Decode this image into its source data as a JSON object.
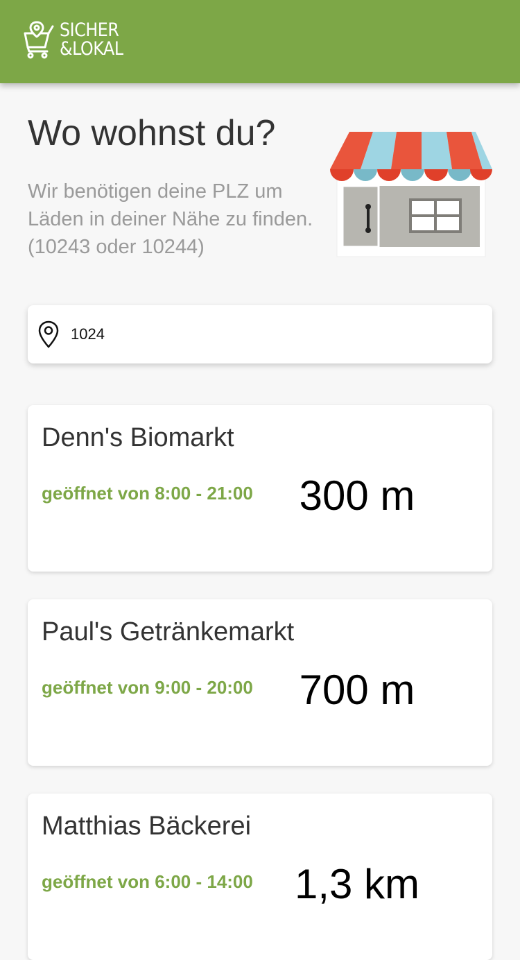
{
  "colors": {
    "brand": "#7da747",
    "text": "#333333",
    "muted": "#9a9a9a"
  },
  "header": {
    "logo_line1": "SICHER",
    "logo_line2": "&LOKAL",
    "logo_icon": "cart-pin-icon"
  },
  "hero": {
    "title": "Wo wohnst du?",
    "subtitle": "Wir benötigen deine PLZ um Läden in deiner Nähe zu finden. (10243 oder 10244)",
    "illustration": "storefront-icon"
  },
  "search": {
    "icon": "location-pin-icon",
    "value": "1024",
    "placeholder": ""
  },
  "stores": [
    {
      "name": "Denn's Biomarkt",
      "hours": "geöffnet von 8:00 - 21:00",
      "distance": "300 m"
    },
    {
      "name": "Paul's Getränkemarkt",
      "hours": "geöffnet von 9:00 - 20:00",
      "distance": "700 m"
    },
    {
      "name": "Matthias Bäckerei",
      "hours": "geöffnet von 6:00 - 14:00",
      "distance": "1,3 km"
    }
  ]
}
